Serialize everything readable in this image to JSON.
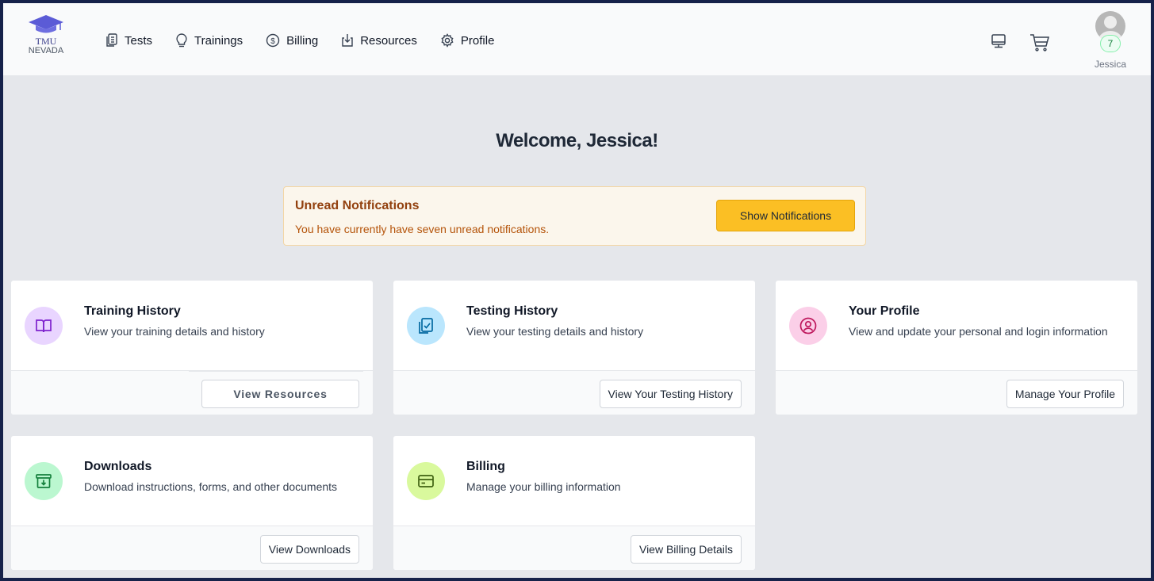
{
  "brand": {
    "line1": "TMU",
    "line2": "NEVADA",
    "icon": "graduation-cap-icon",
    "color": "#5b5bd6"
  },
  "nav": [
    {
      "label": "Tests",
      "icon": "clipboard-list-icon"
    },
    {
      "label": "Trainings",
      "icon": "lightbulb-icon"
    },
    {
      "label": "Billing",
      "icon": "dollar-circle-icon"
    },
    {
      "label": "Resources",
      "icon": "download-tray-icon"
    },
    {
      "label": "Profile",
      "icon": "gear-icon"
    }
  ],
  "header_icons": [
    "monitor-icon",
    "shopping-cart-icon"
  ],
  "user": {
    "name": "Jessica",
    "notification_count": "7"
  },
  "welcome": "Welcome, Jessica!",
  "notification": {
    "title": "Unread Notifications",
    "text": "You have currently have seven unread notifications.",
    "button": "Show Notifications"
  },
  "cards": [
    {
      "title": "Training History",
      "desc": "View your training details and history",
      "button": "View Resources",
      "icon": "book-open-icon",
      "icon_bg": "#e9d5ff",
      "icon_color": "#7e22ce"
    },
    {
      "title": "Testing History",
      "desc": "View your testing details and history",
      "button": "View Your Testing History",
      "icon": "clipboard-check-icon",
      "icon_bg": "#bae6fd",
      "icon_color": "#0369a1"
    },
    {
      "title": "Your Profile",
      "desc": "View and update your personal and login information",
      "button": "Manage Your Profile",
      "icon": "user-circle-icon",
      "icon_bg": "#fbcfe8",
      "icon_color": "#be185d"
    },
    {
      "title": "Downloads",
      "desc": "Download instructions, forms, and other documents",
      "button": "View Downloads",
      "icon": "archive-download-icon",
      "icon_bg": "#bbf7d0",
      "icon_color": "#15803d"
    },
    {
      "title": "Billing",
      "desc": "Manage your billing information",
      "button": "View Billing Details",
      "icon": "credit-card-icon",
      "icon_bg": "#d9f99d",
      "icon_color": "#4d7c0f"
    }
  ],
  "colors": {
    "accent": "#fbbf24",
    "page_bg": "#e5e7eb",
    "frame": "#16224a"
  }
}
